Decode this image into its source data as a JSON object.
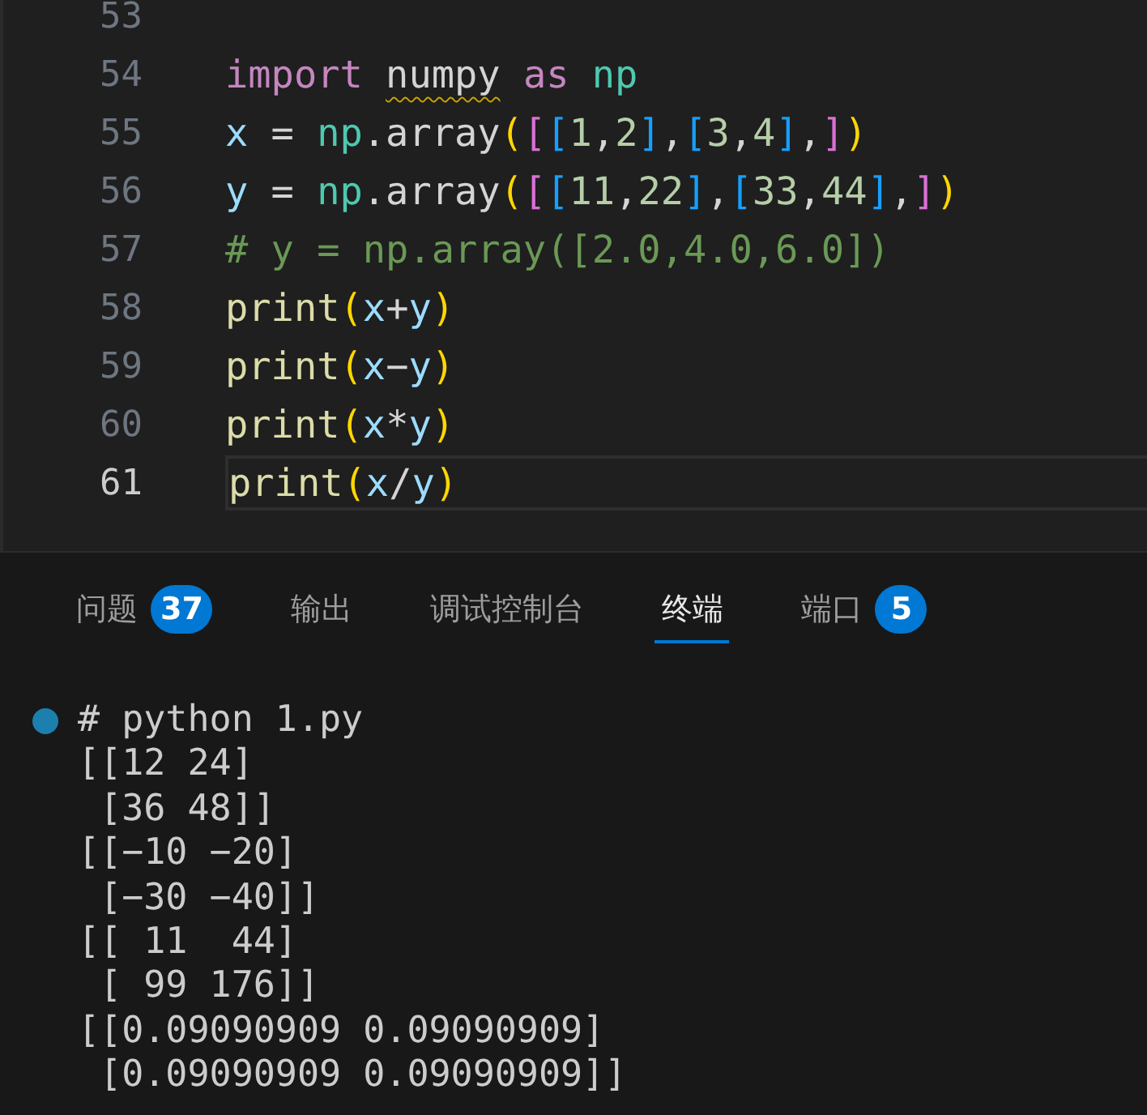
{
  "editor": {
    "lines": [
      {
        "number": "53",
        "current": false
      },
      {
        "number": "54",
        "current": false,
        "tokens": [
          {
            "text": "import ",
            "kind": "keyword"
          },
          {
            "text": "numpy",
            "kind": "unresolved"
          },
          {
            "text": " as ",
            "kind": "keyword"
          },
          {
            "text": "np",
            "kind": "module"
          }
        ]
      },
      {
        "number": "55",
        "current": false,
        "tokens": [
          {
            "text": "x",
            "kind": "variable"
          },
          {
            "text": " = ",
            "kind": "plain"
          },
          {
            "text": "np",
            "kind": "module"
          },
          {
            "text": ".array",
            "kind": "plain"
          },
          {
            "text": "(",
            "kind": "bracket1"
          },
          {
            "text": "[",
            "kind": "bracket2"
          },
          {
            "text": "[",
            "kind": "bracket3"
          },
          {
            "text": "1",
            "kind": "number"
          },
          {
            "text": ",",
            "kind": "plain"
          },
          {
            "text": "2",
            "kind": "number"
          },
          {
            "text": "]",
            "kind": "bracket3"
          },
          {
            "text": ",",
            "kind": "plain"
          },
          {
            "text": "[",
            "kind": "bracket3"
          },
          {
            "text": "3",
            "kind": "number"
          },
          {
            "text": ",",
            "kind": "plain"
          },
          {
            "text": "4",
            "kind": "number"
          },
          {
            "text": "]",
            "kind": "bracket3"
          },
          {
            "text": ",",
            "kind": "plain"
          },
          {
            "text": "]",
            "kind": "bracket2"
          },
          {
            "text": ")",
            "kind": "bracket1"
          }
        ]
      },
      {
        "number": "56",
        "current": false,
        "tokens": [
          {
            "text": "y",
            "kind": "variable"
          },
          {
            "text": " = ",
            "kind": "plain"
          },
          {
            "text": "np",
            "kind": "module"
          },
          {
            "text": ".array",
            "kind": "plain"
          },
          {
            "text": "(",
            "kind": "bracket1"
          },
          {
            "text": "[",
            "kind": "bracket2"
          },
          {
            "text": "[",
            "kind": "bracket3"
          },
          {
            "text": "11",
            "kind": "number"
          },
          {
            "text": ",",
            "kind": "plain"
          },
          {
            "text": "22",
            "kind": "number"
          },
          {
            "text": "]",
            "kind": "bracket3"
          },
          {
            "text": ",",
            "kind": "plain"
          },
          {
            "text": "[",
            "kind": "bracket3"
          },
          {
            "text": "33",
            "kind": "number"
          },
          {
            "text": ",",
            "kind": "plain"
          },
          {
            "text": "44",
            "kind": "number"
          },
          {
            "text": "]",
            "kind": "bracket3"
          },
          {
            "text": ",",
            "kind": "plain"
          },
          {
            "text": "]",
            "kind": "bracket2"
          },
          {
            "text": ")",
            "kind": "bracket1"
          }
        ]
      },
      {
        "number": "57",
        "current": false,
        "tokens": [
          {
            "text": "# y = np.array([2.0,4.0,6.0])",
            "kind": "comment"
          }
        ]
      },
      {
        "number": "58",
        "current": false,
        "tokens": [
          {
            "text": "print",
            "kind": "function"
          },
          {
            "text": "(",
            "kind": "bracket1"
          },
          {
            "text": "x",
            "kind": "variable"
          },
          {
            "text": "+",
            "kind": "plain"
          },
          {
            "text": "y",
            "kind": "variable"
          },
          {
            "text": ")",
            "kind": "bracket1"
          }
        ]
      },
      {
        "number": "59",
        "current": false,
        "tokens": [
          {
            "text": "print",
            "kind": "function"
          },
          {
            "text": "(",
            "kind": "bracket1"
          },
          {
            "text": "x",
            "kind": "variable"
          },
          {
            "text": "−",
            "kind": "plain"
          },
          {
            "text": "y",
            "kind": "variable"
          },
          {
            "text": ")",
            "kind": "bracket1"
          }
        ]
      },
      {
        "number": "60",
        "current": false,
        "tokens": [
          {
            "text": "print",
            "kind": "function"
          },
          {
            "text": "(",
            "kind": "bracket1"
          },
          {
            "text": "x",
            "kind": "variable"
          },
          {
            "text": "*",
            "kind": "plain"
          },
          {
            "text": "y",
            "kind": "variable"
          },
          {
            "text": ")",
            "kind": "bracket1"
          }
        ]
      },
      {
        "number": "61",
        "current": true,
        "tokens": [
          {
            "text": "print",
            "kind": "function"
          },
          {
            "text": "(",
            "kind": "bracket1"
          },
          {
            "text": "x",
            "kind": "variable"
          },
          {
            "text": "/",
            "kind": "plain"
          },
          {
            "text": "y",
            "kind": "variable"
          },
          {
            "text": ")",
            "kind": "bracket1"
          }
        ]
      }
    ]
  },
  "panel": {
    "tabs": [
      {
        "label": "问题",
        "badge": "37",
        "selected": false
      },
      {
        "label": "输出",
        "selected": false
      },
      {
        "label": "调试控制台",
        "selected": false
      },
      {
        "label": "终端",
        "selected": true
      },
      {
        "label": "端口",
        "badge": "5",
        "selected": false
      }
    ],
    "terminal": {
      "command": "# python 1.py",
      "output": [
        "[[12 24]",
        " [36 48]]",
        "[[−10 −20]",
        " [−30 −40]]",
        "[[ 11  44]",
        " [ 99 176]]",
        "[[0.09090909 0.09090909]",
        " [0.09090909 0.09090909]]"
      ]
    }
  }
}
